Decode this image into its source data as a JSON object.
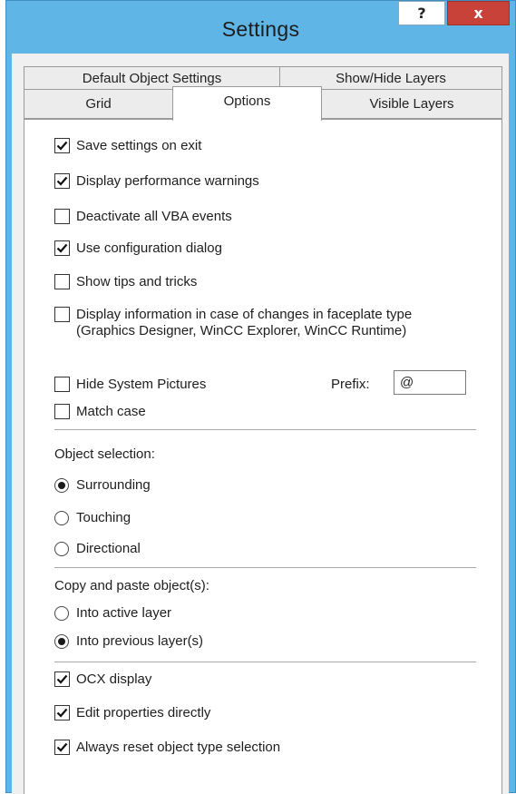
{
  "window": {
    "title": "Settings",
    "help_label": "?",
    "close_label": "x"
  },
  "tabs": {
    "top_row": [
      "Default Object Settings",
      "Show/Hide Layers"
    ],
    "bottom_row": [
      "Grid",
      "Options",
      "Visible Layers"
    ],
    "active": "Options"
  },
  "options": {
    "save_settings": {
      "label": "Save settings on exit",
      "checked": true
    },
    "perf_warnings": {
      "label": "Display performance warnings",
      "checked": true
    },
    "deactivate_vba": {
      "label": "Deactivate all VBA events",
      "checked": false
    },
    "config_dialog": {
      "label": "Use configuration dialog",
      "checked": true
    },
    "tips_tricks": {
      "label": "Show tips and tricks",
      "checked": false
    },
    "faceplate_info": {
      "label": "Display information in case of changes in faceplate type (Graphics Designer, WinCC Explorer, WinCC Runtime)",
      "checked": false
    },
    "hide_system_pictures": {
      "label": "Hide System Pictures",
      "checked": false
    },
    "prefix_label": "Prefix:",
    "prefix_value": "@",
    "match_case": {
      "label": "Match case",
      "checked": false
    }
  },
  "object_selection": {
    "heading": "Object selection:",
    "surrounding": {
      "label": "Surrounding",
      "selected": true
    },
    "touching": {
      "label": "Touching",
      "selected": false
    },
    "directional": {
      "label": "Directional",
      "selected": false
    }
  },
  "copy_paste": {
    "heading": "Copy and paste object(s):",
    "into_active": {
      "label": "Into active layer",
      "selected": false
    },
    "into_previous": {
      "label": "Into previous layer(s)",
      "selected": true
    }
  },
  "misc": {
    "ocx_display": {
      "label": "OCX display",
      "checked": true
    },
    "edit_properties": {
      "label": "Edit properties directly",
      "checked": true
    },
    "reset_object_type": {
      "label": "Always reset object type selection",
      "checked": true
    }
  },
  "colors": {
    "title_bar": "#5fb6e6",
    "close_button": "#c9423a",
    "panel": "#ffffff"
  }
}
